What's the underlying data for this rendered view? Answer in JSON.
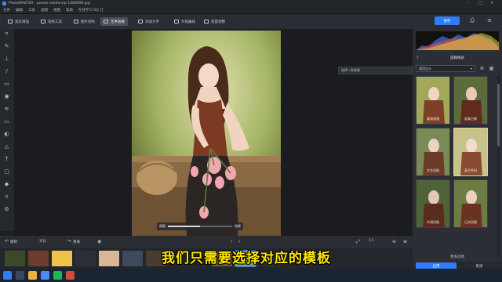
{
  "window": {
    "title": "PhotoMASTER - pexels-soldiervip-1386696.jpg"
  },
  "menu": [
    "文件",
    "编辑",
    "工具",
    "滤镜",
    "视图",
    "帮助",
    "在线学习 SQ 订"
  ],
  "toolbar": {
    "tools": [
      {
        "label": "美化增强",
        "icon": "enhance-icon"
      },
      {
        "label": "润色工具",
        "icon": "retouch-icon"
      },
      {
        "label": "图片调色",
        "icon": "color-icon"
      },
      {
        "label": "艺术效果",
        "icon": "art-effect-icon",
        "active": true
      },
      {
        "label": "添加文字",
        "icon": "text-icon"
      },
      {
        "label": "外观编排",
        "icon": "layout-icon"
      },
      {
        "label": "批量调整",
        "icon": "batch-icon"
      }
    ],
    "save_label": "保存"
  },
  "canvas": {
    "compare_label": "原图",
    "after_label": "效果",
    "compare_fraction": 0.5
  },
  "bottom": {
    "undo_label": "撤销",
    "compare_label": "对比",
    "redo_label": "重做",
    "zoom_label": "1:1"
  },
  "panel": {
    "header": "选择样式",
    "preset_select": "通用设计",
    "hover_hint": "选择一款效果",
    "templates": [
      {
        "label": "暖调滤镜"
      },
      {
        "label": "轻柔古典"
      },
      {
        "label": "文艺风格"
      },
      {
        "label": "复古怀旧"
      },
      {
        "label": "冷调风格"
      },
      {
        "label": "日式风格"
      }
    ],
    "more_options": "更多选项",
    "apply_label": "应用",
    "cancel_label": "取消"
  },
  "subtitle": "我们只需要选择对应的模板",
  "colors": {
    "accent": "#2f7cf6",
    "subtitle": "#ffe600",
    "selected_border": "#e8d66a"
  }
}
